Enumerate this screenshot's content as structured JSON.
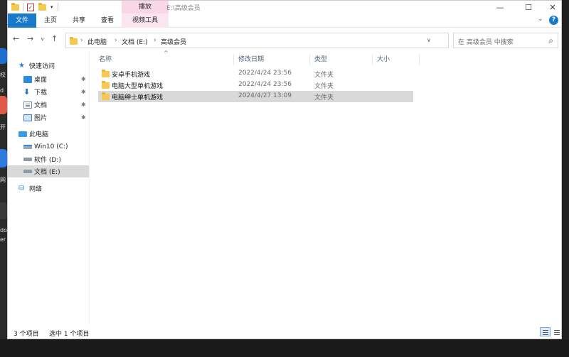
{
  "desktop": {
    "edge_texts": [
      "校",
      "d",
      "开",
      "网",
      "do",
      "er"
    ]
  },
  "window": {
    "title": "E:\\高级会员",
    "context_group_label": "播放",
    "controls": {
      "minimize": "—",
      "maximize": "☐",
      "close": "✕"
    }
  },
  "ribbon": {
    "tabs": [
      "文件",
      "主页",
      "共享",
      "查看",
      "视频工具"
    ],
    "collapse_icon": "chevron-down-icon",
    "help": "?"
  },
  "address": {
    "crumbs": [
      "此电脑",
      "文档 (E:)",
      "高级会员"
    ]
  },
  "search": {
    "placeholder": "在 高级会员 中搜索"
  },
  "sidebar": {
    "items": [
      {
        "label": "快速访问",
        "icon": "star-icon"
      },
      {
        "label": "桌面",
        "icon": "desktop-icon",
        "pinned": true
      },
      {
        "label": "下载",
        "icon": "download-icon",
        "pinned": true
      },
      {
        "label": "文档",
        "icon": "document-icon",
        "pinned": true
      },
      {
        "label": "图片",
        "icon": "pictures-icon",
        "pinned": true
      },
      {
        "label": "此电脑",
        "icon": "pc-icon"
      },
      {
        "label": "Win10 (C:)",
        "icon": "drive-icon"
      },
      {
        "label": "软件 (D:)",
        "icon": "drive-icon"
      },
      {
        "label": "文档 (E:)",
        "icon": "drive-icon",
        "selected": true
      },
      {
        "label": "网络",
        "icon": "network-icon"
      }
    ]
  },
  "columns": [
    "名称",
    "修改日期",
    "类型",
    "大小"
  ],
  "files": [
    {
      "name": "安卓手机游戏",
      "date": "2022/4/24 23:56",
      "type": "文件夹"
    },
    {
      "name": "电脑大型单机游戏",
      "date": "2022/4/24 23:56",
      "type": "文件夹"
    },
    {
      "name": "电脑绅士单机游戏",
      "date": "2024/4/27 13:09",
      "type": "文件夹",
      "selected": true
    }
  ],
  "status": {
    "item_count": "3 个项目",
    "selected_count": "选中 1 个项目"
  }
}
